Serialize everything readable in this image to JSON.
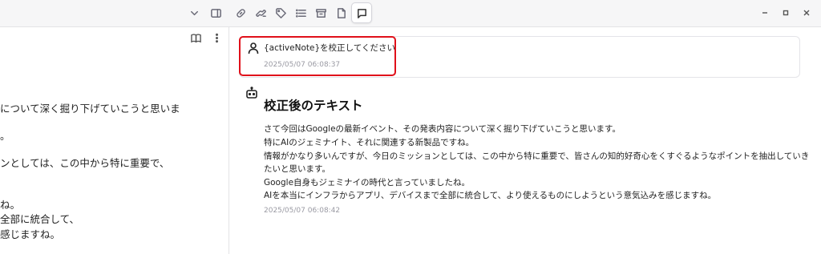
{
  "toolbar": {
    "icons": [
      "chevron-down-icon",
      "sidebar-toggle-icon",
      "link-icon",
      "link-alt-icon",
      "tag-icon",
      "list-icon",
      "archive-icon",
      "file-icon",
      "chat-icon"
    ],
    "active": "chat-icon"
  },
  "left_pane": {
    "lines": [
      "について深く掘り下げていこうと思いま",
      "。",
      "ンとしては、この中から特に重要で、",
      "ね。",
      "全部に統合して、",
      "感じますね。"
    ]
  },
  "chat": {
    "user": {
      "text": "{activeNote}を校正してください",
      "timestamp": "2025/05/07 06:08:37"
    },
    "assistant": {
      "heading": "校正後のテキスト",
      "lines": [
        "さて今回はGoogleの最新イベント、その発表内容について深く掘り下げていこうと思います。",
        "特にAIのジェミナイト、それに関連する新製品ですね。",
        "情報がかなり多いんですが、今日のミッションとしては、この中から特に重要で、皆さんの知的好奇心をくすぐるようなポイントを抽出していき",
        "たいと思います。",
        "Google自身もジェミナイの時代と言っていましたね。",
        "AIを本当にインフラからアプリ、デバイスまで全部に統合して、より使えるものにしようという意気込みを感じますね。"
      ],
      "timestamp": "2025/05/07 06:08:42"
    }
  },
  "colors": {
    "highlight": "#e0101a",
    "timestamp": "#9a9aa3"
  }
}
